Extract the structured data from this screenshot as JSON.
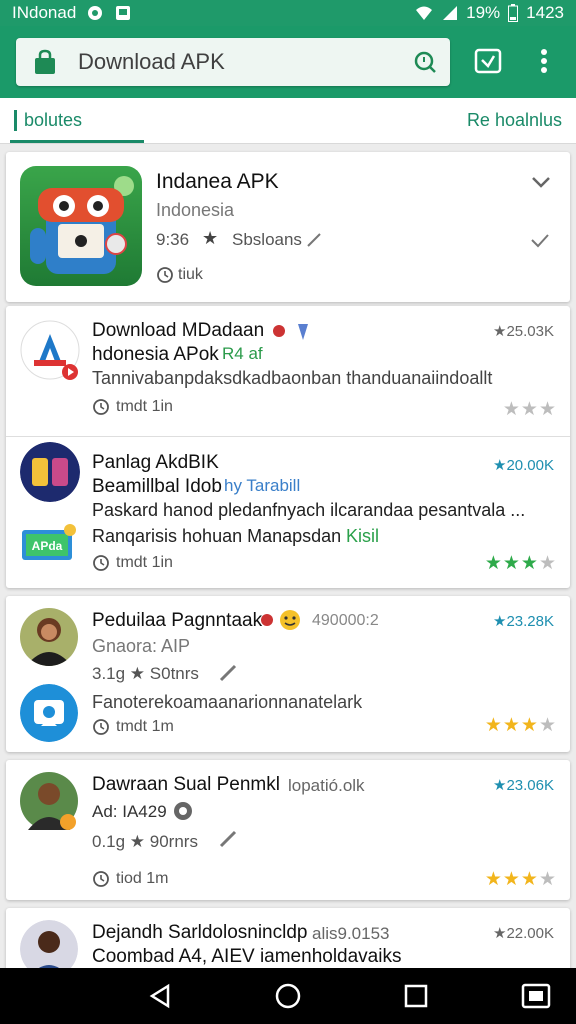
{
  "status_bar": {
    "carrier": "INdonad",
    "battery": "19%",
    "time": "1423",
    "icons": [
      "settings-icon",
      "image-icon",
      "wifi-icon",
      "signal-icon",
      "battery-icon"
    ]
  },
  "app_bar": {
    "search_title": "Download APK",
    "icons": [
      "shopping-bag-icon",
      "search-icon",
      "checkbox-icon",
      "more-vert-icon"
    ]
  },
  "tabs": {
    "left": "bolutes",
    "right": "Re hoalnlus"
  },
  "featured": {
    "title": "Indanea APK",
    "subtitle": "Indonesia",
    "rating": "9:36",
    "star": "★",
    "rating_note": "Sbsloans",
    "extra": "tiuk"
  },
  "items": [
    {
      "title": "Download MDadaan",
      "line2": "hdonesia APok",
      "line2_extra": "R4 af",
      "desc": "Tannivabanpdaksdkadbaonban thanduanaiindoallt",
      "meta": "tmdt  1in",
      "count": "★25.03K",
      "stars": [
        0,
        0,
        0
      ]
    },
    {
      "title": "Panlag AkdBIK",
      "line2": "Beamillbal Idob",
      "line2_extra": "hy Tarabill",
      "desc": "Paskard hanod pledanfnyach ilcarandaa pesantvala ...",
      "desc2": "Ranqarisis hohuan Manapsdan",
      "desc2_extra": "Kisil",
      "meta": "tmdt  1in",
      "count": "★20.00K",
      "stars": [
        1,
        1,
        1,
        0
      ]
    },
    {
      "title": "Peduilaa Pagnntaak",
      "title_extra": "490000:2",
      "line2": "Gnaora: AIP",
      "rating": "3.1g ★ S0tnrs",
      "desc": "Fanoterekoamaanarionnanatelark",
      "meta": "tmdt  1m",
      "count": "★23.28K",
      "stars": [
        0.5,
        1,
        1,
        0
      ]
    },
    {
      "title": "Dawraan Sual Penmkl",
      "title_extra": "lopatió.olk",
      "line2": "Ad: IA429",
      "rating": "0.1g ★ 90rnrs",
      "meta": "tiod  1m",
      "count": "★23.06K",
      "stars": [
        0.5,
        1,
        1,
        0
      ]
    },
    {
      "title": "Dejandh Sarldolosnincldp",
      "title_extra": "alis9.0153",
      "line2": "Coombad A4, AIEV  iamenholdavaiks",
      "count": "★22.00K"
    }
  ],
  "colors": {
    "brand_green": "#1b9a69",
    "tab_green": "#1a8a68",
    "count_blue": "#1e8fb0",
    "star_green": "#2eaa4a",
    "star_yellow": "#f2b51c",
    "star_grey": "#bdbdbd"
  },
  "nav_bar": {
    "icons": [
      "back-icon",
      "home-icon",
      "recents-icon",
      "screenshot-icon"
    ]
  }
}
